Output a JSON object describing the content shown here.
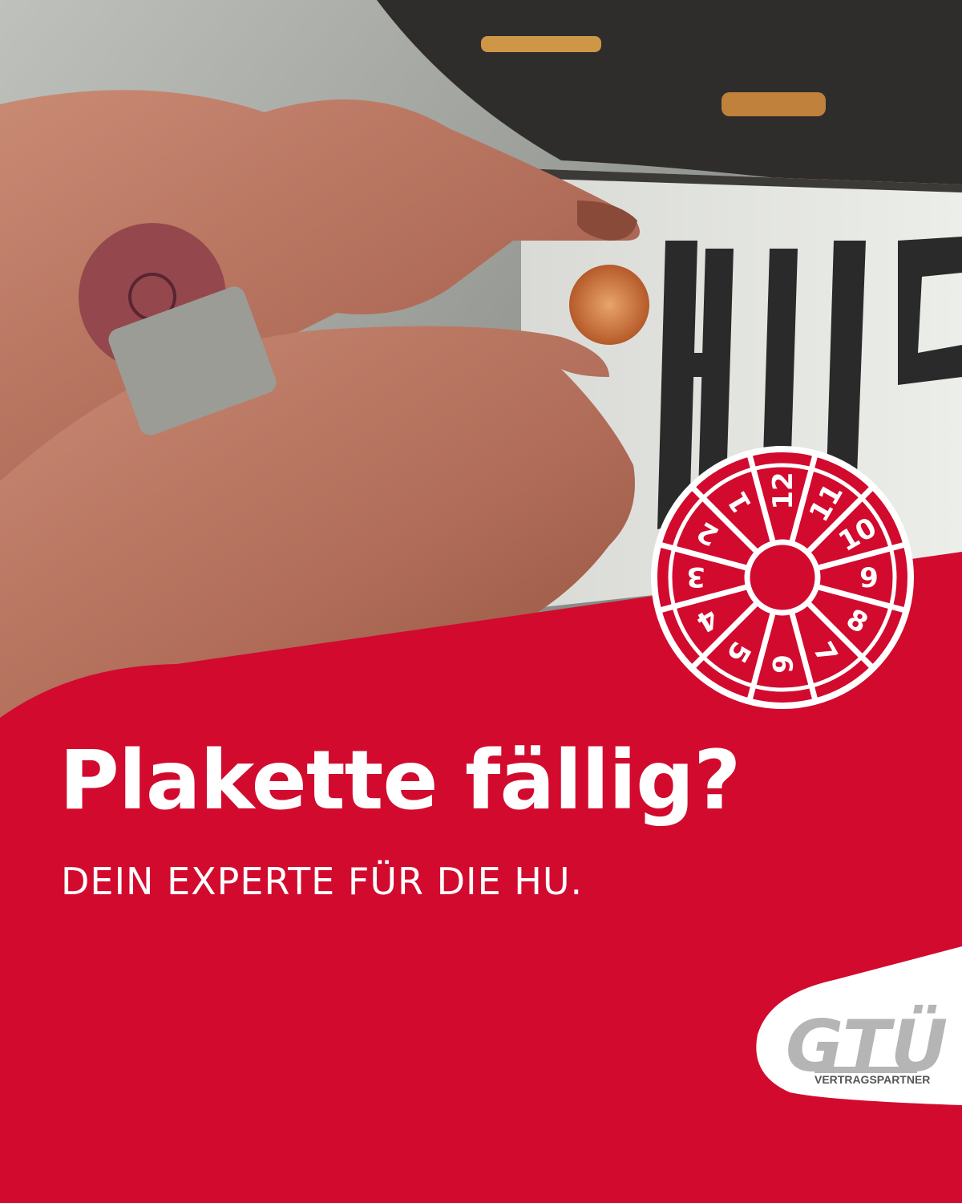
{
  "headline": "Plakette fällig?",
  "subline": "DEIN EXPERTE FÜR DIE HU.",
  "badge": {
    "months": [
      "12",
      "11",
      "10",
      "9",
      "8",
      "7",
      "6",
      "5",
      "4",
      "3",
      "2",
      "1"
    ]
  },
  "logo": {
    "wordmark": "GTÜ",
    "tagline": "VERTRAGSPARTNER"
  },
  "colors": {
    "brand_red": "#d20a2e",
    "white": "#ffffff",
    "logo_gray": "#b5b5b5"
  }
}
